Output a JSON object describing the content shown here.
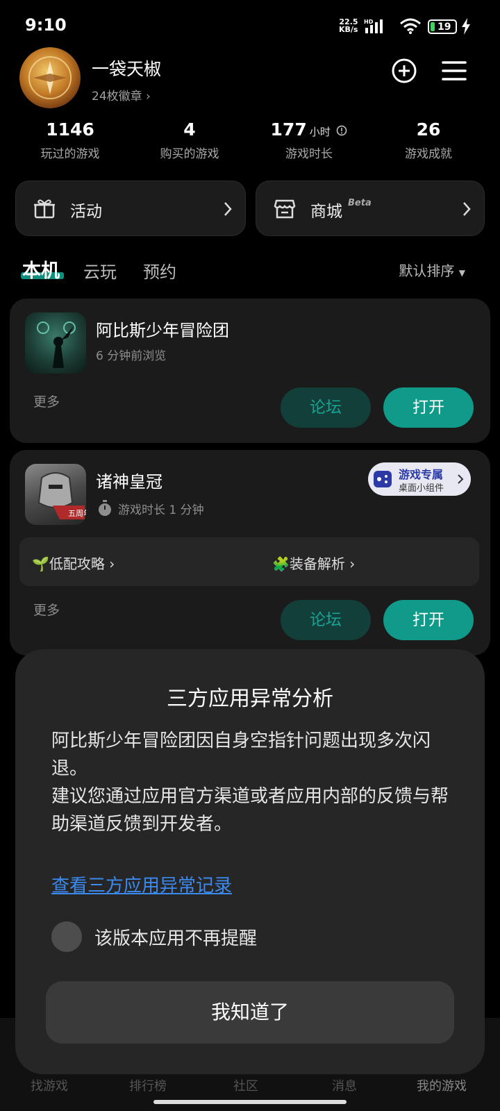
{
  "status": {
    "time": "9:10",
    "net_speed": "22.5",
    "net_unit": "KB/s",
    "net_type": "HD",
    "battery": "19"
  },
  "profile": {
    "username": "一袋天椒",
    "badges": "24枚徽章 ›",
    "add_icon": "plus-circle-icon",
    "menu_icon": "hamburger-menu-icon"
  },
  "stats": [
    {
      "value": "1146",
      "unit": "",
      "label": "玩过的游戏"
    },
    {
      "value": "4",
      "unit": "",
      "label": "购买的游戏"
    },
    {
      "value": "177",
      "unit": "小时",
      "label": "游戏时长"
    },
    {
      "value": "26",
      "unit": "",
      "label": "游戏成就"
    }
  ],
  "actions": {
    "activity": "活动",
    "store": "商城",
    "store_badge": "Beta"
  },
  "tabs": [
    {
      "label": "本机",
      "active": true
    },
    {
      "label": "云玩",
      "active": false
    },
    {
      "label": "预约",
      "active": false
    }
  ],
  "sort_label": "默认排序",
  "games": [
    {
      "title": "阿比斯少年冒险团",
      "subtitle": "6 分钟前浏览",
      "more": "更多",
      "forum": "论坛",
      "open": "打开"
    },
    {
      "title": "诸神皇冠",
      "subtitle": "游戏时长 1 分钟",
      "widget_title": "游戏专属",
      "widget_sub": "桌面小组件",
      "guide1": "低配攻略",
      "guide2": "装备解析",
      "icon_tag": "五周年",
      "more": "更多",
      "forum": "论坛",
      "open": "打开"
    }
  ],
  "dialog": {
    "title": "三方应用异常分析",
    "body": "阿比斯少年冒险团因自身空指针问题出现多次闪退。\n建议您通过应用官方渠道或者应用内部的反馈与帮助渠道反馈到开发者。",
    "link": "查看三方应用异常记录",
    "checkbox": "该版本应用不再提醒",
    "button": "我知道了"
  },
  "bottom_nav": [
    "找游戏",
    "排行榜",
    "社区",
    "消息",
    "我的游戏"
  ]
}
